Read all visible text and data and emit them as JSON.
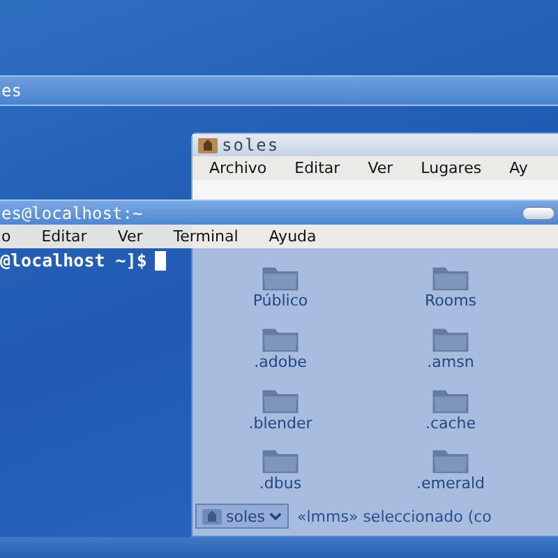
{
  "back_window": {
    "title": "es"
  },
  "file_manager": {
    "title": "soles",
    "menu": [
      "Archivo",
      "Editar",
      "Ver",
      "Lugares",
      "Ay"
    ],
    "items": [
      {
        "name": "Público"
      },
      {
        "name": "Rooms"
      },
      {
        "name": ".adobe"
      },
      {
        "name": ".amsn"
      },
      {
        "name": ".blender"
      },
      {
        "name": ".cache"
      },
      {
        "name": ".dbus"
      },
      {
        "name": ".emerald"
      }
    ],
    "location": "soles",
    "status": "«lmms» seleccionado (co"
  },
  "terminal": {
    "title": "es@localhost:~",
    "menu": [
      "o",
      "Editar",
      "Ver",
      "Terminal",
      "Ayuda"
    ],
    "prompt": "@localhost ~]$"
  }
}
